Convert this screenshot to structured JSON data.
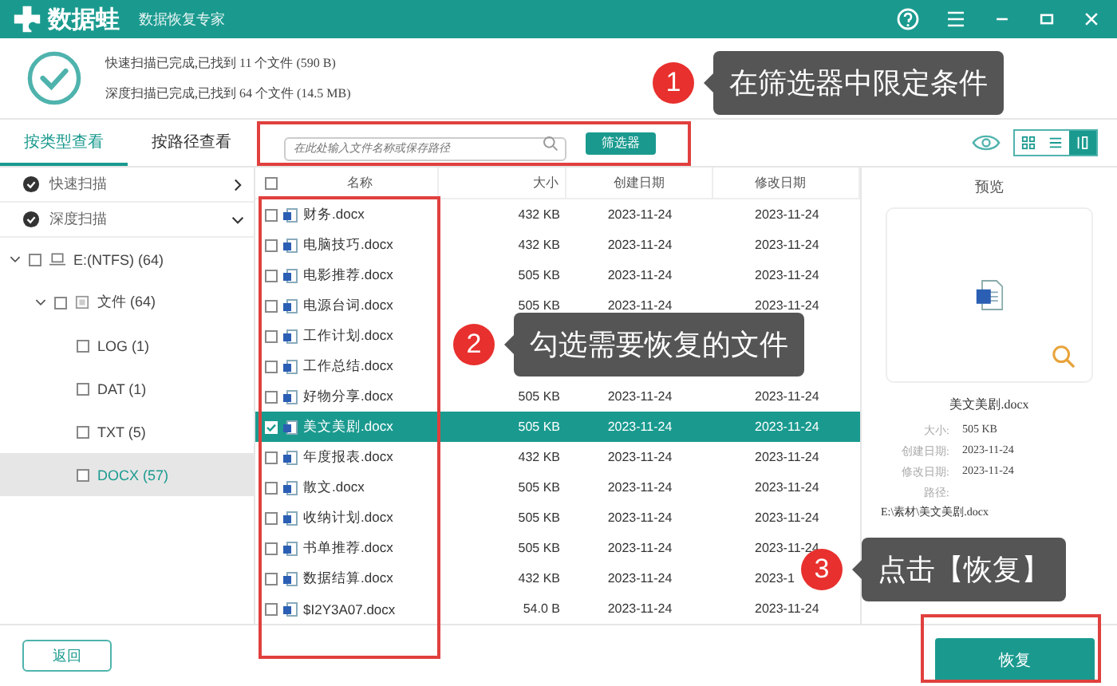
{
  "app": {
    "name": "数据蛙",
    "subtitle": "数据恢复专家"
  },
  "scan_summary": [
    "快速扫描已完成,已找到 11 个文件 (590 B)",
    "深度扫描已完成,已找到 64 个文件 (14.5 MB)"
  ],
  "view_tabs": [
    {
      "label": "按类型查看",
      "selected": true
    },
    {
      "label": "按路径查看",
      "selected": false
    }
  ],
  "search": {
    "placeholder": "在此处输入文件名称或保存路径"
  },
  "filter_button": "筛选器",
  "view_modes": [
    {
      "kind": "grid",
      "selected": false
    },
    {
      "kind": "list",
      "selected": false
    },
    {
      "kind": "detail",
      "selected": true
    }
  ],
  "scans": [
    {
      "label": "快速扫描",
      "expanded": false
    },
    {
      "label": "深度扫描",
      "expanded": true
    }
  ],
  "tree": [
    {
      "label": "E:(NTFS) (64)",
      "kind": "drive",
      "expanded": true,
      "selected": false,
      "children": [
        {
          "label": "文件 (64)",
          "kind": "folder",
          "expanded": true,
          "selected": false,
          "children": [
            {
              "label": "LOG (1)",
              "selected": false
            },
            {
              "label": "DAT (1)",
              "selected": false
            },
            {
              "label": "TXT (5)",
              "selected": false
            },
            {
              "label": "DOCX (57)",
              "selected": true
            }
          ]
        }
      ]
    }
  ],
  "table": {
    "columns": [
      "名称",
      "大小",
      "创建日期",
      "修改日期"
    ],
    "rows": [
      {
        "name": "财务.docx",
        "size": "432 KB",
        "created": "2023-11-24",
        "modified": "2023-11-24",
        "checked": false,
        "selected": false
      },
      {
        "name": "电脑技巧.docx",
        "size": "432 KB",
        "created": "2023-11-24",
        "modified": "2023-11-24",
        "checked": false,
        "selected": false
      },
      {
        "name": "电影推荐.docx",
        "size": "505 KB",
        "created": "2023-11-24",
        "modified": "2023-11-24",
        "checked": false,
        "selected": false
      },
      {
        "name": "电源台词.docx",
        "size": "505 KB",
        "created": "2023-11-24",
        "modified": "2023-11-24",
        "checked": false,
        "selected": false
      },
      {
        "name": "工作计划.docx",
        "checked": false,
        "selected": false
      },
      {
        "name": "工作总结.docx",
        "checked": false,
        "selected": false
      },
      {
        "name": "好物分享.docx",
        "size": "505 KB",
        "created": "2023-11-24",
        "modified": "2023-11-24",
        "checked": false,
        "selected": false
      },
      {
        "name": "美文美剧.docx",
        "size": "505 KB",
        "created": "2023-11-24",
        "modified": "2023-11-24",
        "checked": true,
        "selected": true
      },
      {
        "name": "年度报表.docx",
        "size": "432 KB",
        "created": "2023-11-24",
        "modified": "2023-11-24",
        "checked": false,
        "selected": false
      },
      {
        "name": "散文.docx",
        "size": "505 KB",
        "created": "2023-11-24",
        "modified": "2023-11-24",
        "checked": false,
        "selected": false
      },
      {
        "name": "收纳计划.docx",
        "size": "505 KB",
        "created": "2023-11-24",
        "modified": "2023-11-24",
        "checked": false,
        "selected": false
      },
      {
        "name": "书单推荐.docx",
        "size": "505 KB",
        "created": "2023-11-24",
        "modified": "2023-11-24",
        "checked": false,
        "selected": false
      },
      {
        "name": "数据结算.docx",
        "size": "432 KB",
        "created": "2023-11-24",
        "modified": "2023-1",
        "checked": false,
        "selected": false
      },
      {
        "name": "$I2Y3A07.docx",
        "size": "54.0 B",
        "created": "2023-11-24",
        "modified": "2023-11-24",
        "checked": false,
        "selected": false
      }
    ]
  },
  "preview": {
    "title": "预览",
    "file_name": "美文美剧.docx",
    "details": [
      {
        "label": "大小:",
        "value": "505 KB"
      },
      {
        "label": "创建日期:",
        "value": "2023-11-24"
      },
      {
        "label": "修改日期:",
        "value": "2023-11-24"
      }
    ],
    "path_label": "路径:",
    "path": "E:\\素材\\美文美剧.docx"
  },
  "buttons": {
    "back": "返回",
    "restore": "恢复"
  },
  "annotations": [
    {
      "number": "1",
      "text": "在筛选器中限定条件"
    },
    {
      "number": "2",
      "text": "勾选需要恢复的文件"
    },
    {
      "number": "3",
      "text": "点击【恢复】"
    }
  ]
}
